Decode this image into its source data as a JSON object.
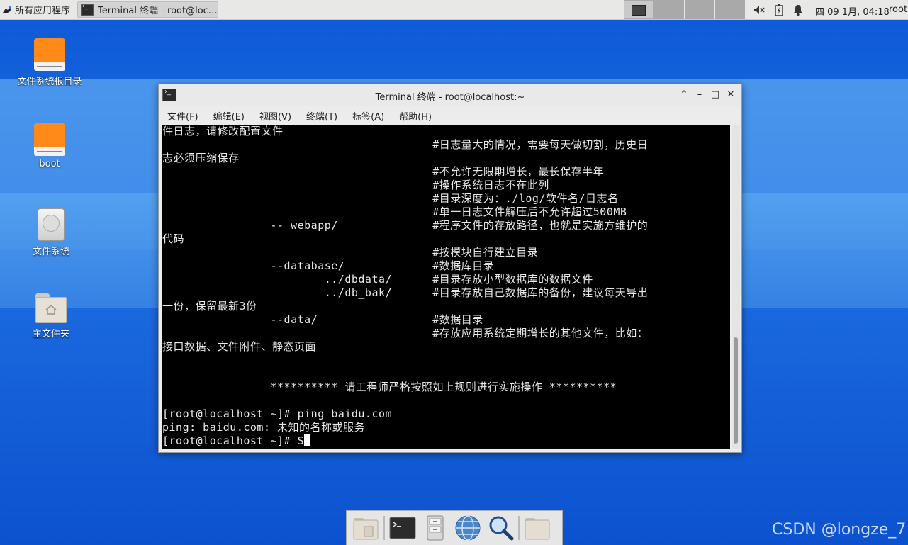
{
  "top_panel": {
    "apps_menu_label": "所有应用程序",
    "taskbar_item": "Terminal 终端 - root@loc…",
    "clock": "四 09 1月, 04:18",
    "user": "root"
  },
  "desktop_icons": [
    {
      "label": "文件系统根目录"
    },
    {
      "label": "boot"
    },
    {
      "label": "文件系统"
    },
    {
      "label": "主文件夹"
    }
  ],
  "terminal": {
    "title": "Terminal 终端 - root@localhost:~",
    "menu": [
      "文件(F)",
      "编辑(E)",
      "视图(V)",
      "终端(T)",
      "标签(A)",
      "帮助(H)"
    ],
    "lines": [
      "件日志，请修改配置文件",
      "                                        #日志量大的情况，需要每天做切割，历史日",
      "志必须压缩保存",
      "                                        #不允许无限期增长，最长保存半年",
      "                                        #操作系统日志不在此列",
      "                                        #目录深度为：./log/软件名/日志名",
      "                                        #单一日志文件解压后不允许超过500MB",
      "                -- webapp/              #程序文件的存放路径，也就是实施方维护的",
      "代码",
      "                                        #按模块自行建立目录",
      "                --database/             #数据库目录",
      "                        ../dbdata/      #目录存放小型数据库的数据文件",
      "                        ../db_bak/      #目录存放自己数据库的备份，建议每天导出",
      "一份，保留最新3份",
      "                --data/                 #数据目录",
      "                                        #存放应用系统定期增长的其他文件，比如：",
      "接口数据、文件附件、静态页面",
      "",
      "",
      "                ********** 请工程师严格按照如上规则进行实施操作 **********",
      "",
      "[root@localhost ~]# ping baidu.com",
      "ping: baidu.com: 未知的名称或服务"
    ],
    "prompt": "[root@localhost ~]# S"
  },
  "dock_items": [
    "file-manager",
    "terminal",
    "file-cabinet",
    "web-browser",
    "search",
    "folder"
  ],
  "watermark": "CSDN @longze_7"
}
